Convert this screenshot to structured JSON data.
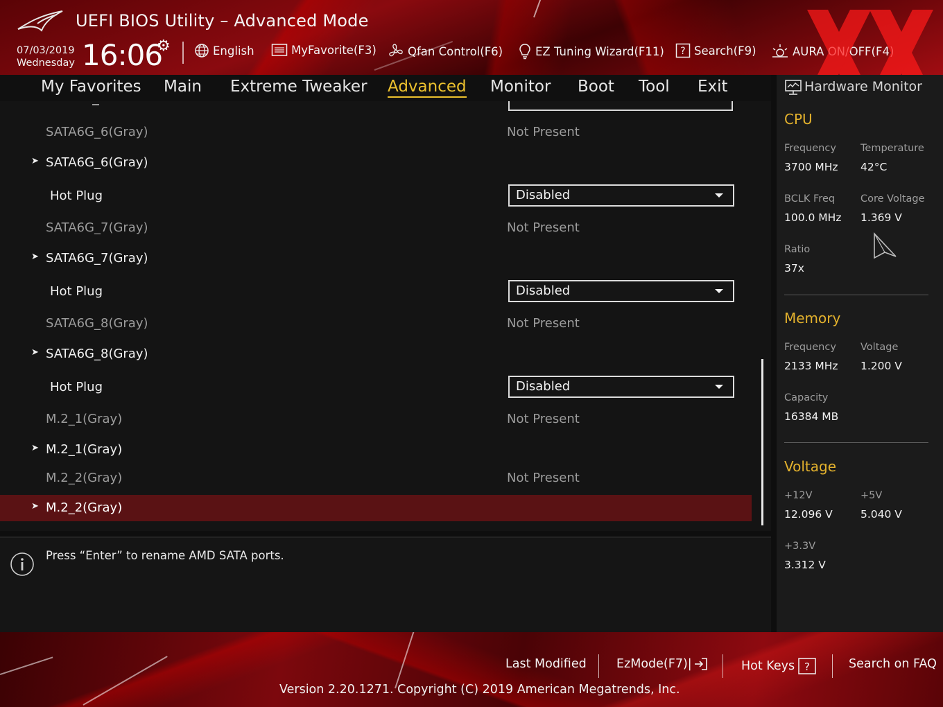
{
  "header": {
    "title": "UEFI BIOS Utility – Advanced Mode",
    "date": "07/03/2019",
    "day": "Wednesday",
    "time": "16:06",
    "tools": [
      {
        "label": "English",
        "icon": "globe-icon"
      },
      {
        "label": "MyFavorite(F3)",
        "icon": "favorite-list-icon"
      },
      {
        "label": "Qfan Control(F6)",
        "icon": "fan-icon"
      },
      {
        "label": "EZ Tuning Wizard(F11)",
        "icon": "lightbulb-icon"
      },
      {
        "label": "Search(F9)",
        "icon": "help-search-icon"
      },
      {
        "label": "AURA ON/OFF(F4)",
        "icon": "aura-light-icon"
      }
    ],
    "accent_color": "#ecc12e"
  },
  "nav": {
    "tabs": [
      "My Favorites",
      "Main",
      "Extreme Tweaker",
      "Advanced",
      "Monitor",
      "Boot",
      "Tool",
      "Exit"
    ],
    "active": "Advanced"
  },
  "list": {
    "rows": [
      {
        "type": "info",
        "label": "SATA6G_6(Gray)",
        "value": "Not Present"
      },
      {
        "type": "submenu",
        "label": "SATA6G_6(Gray)"
      },
      {
        "type": "option",
        "label": "Hot Plug",
        "value": "Disabled"
      },
      {
        "type": "info",
        "label": "SATA6G_7(Gray)",
        "value": "Not Present"
      },
      {
        "type": "submenu",
        "label": "SATA6G_7(Gray)"
      },
      {
        "type": "option",
        "label": "Hot Plug",
        "value": "Disabled"
      },
      {
        "type": "info",
        "label": "SATA6G_8(Gray)",
        "value": "Not Present"
      },
      {
        "type": "submenu",
        "label": "SATA6G_8(Gray)"
      },
      {
        "type": "option",
        "label": "Hot Plug",
        "value": "Disabled"
      },
      {
        "type": "info",
        "label": "M.2_1(Gray)",
        "value": "Not Present"
      },
      {
        "type": "submenu",
        "label": "M.2_1(Gray)"
      },
      {
        "type": "info",
        "label": "M.2_2(Gray)",
        "value": "Not Present"
      },
      {
        "type": "submenu",
        "label": "M.2_2(Gray)",
        "selected": true
      }
    ]
  },
  "info_bar": {
    "text": "Press “Enter” to rename AMD SATA ports."
  },
  "hw_monitor": {
    "title": "Hardware Monitor",
    "cpu": {
      "heading": "CPU",
      "frequency_label": "Frequency",
      "frequency": "3700 MHz",
      "temperature_label": "Temperature",
      "temperature": "42°C",
      "bclk_label": "BCLK Freq",
      "bclk": "100.0 MHz",
      "core_voltage_label": "Core Voltage",
      "core_voltage": "1.369 V",
      "ratio_label": "Ratio",
      "ratio": "37x"
    },
    "memory": {
      "heading": "Memory",
      "frequency_label": "Frequency",
      "frequency": "2133 MHz",
      "voltage_label": "Voltage",
      "voltage": "1.200 V",
      "capacity_label": "Capacity",
      "capacity": "16384 MB"
    },
    "voltage": {
      "heading": "Voltage",
      "v12_label": "+12V",
      "v12": "12.096 V",
      "v5_label": "+5V",
      "v5": "5.040 V",
      "v33_label": "+3.3V",
      "v33": "3.312 V"
    },
    "heading_color": "#e4b22d"
  },
  "footer": {
    "last_modified": "Last Modified",
    "ez_mode": "EzMode(F7)|",
    "hot_keys": "Hot Keys",
    "search_faq": "Search on FAQ",
    "version": "Version 2.20.1271. Copyright (C) 2019 American Megatrends, Inc."
  }
}
